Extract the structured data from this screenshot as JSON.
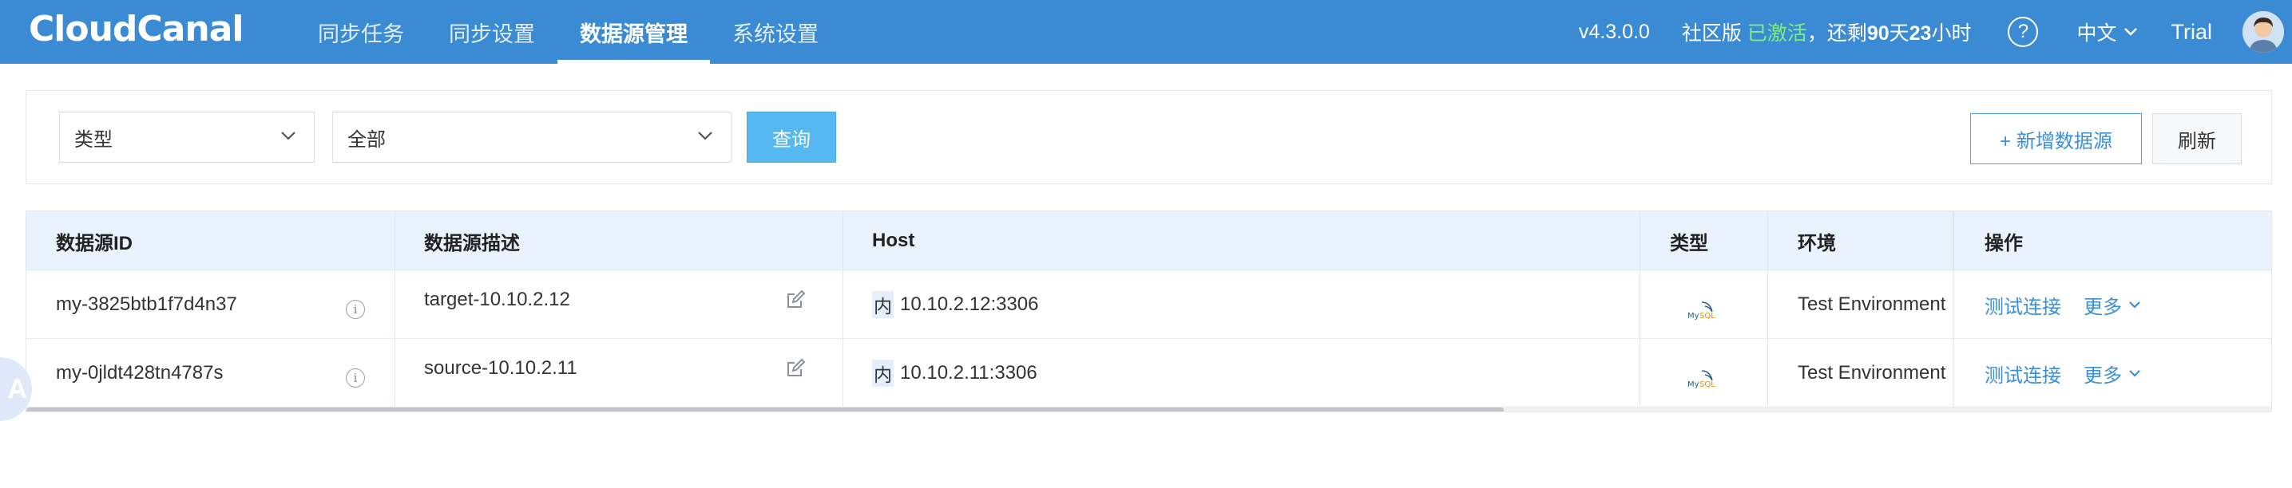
{
  "header": {
    "logo": "CloudCanal",
    "nav": [
      {
        "label": "同步任务",
        "active": false
      },
      {
        "label": "同步设置",
        "active": false
      },
      {
        "label": "数据源管理",
        "active": true
      },
      {
        "label": "系统设置",
        "active": false
      }
    ],
    "version": "v4.3.0.0",
    "edition_prefix": "社区版",
    "edition_status": "已激活",
    "remaining_prefix": "，还剩",
    "remaining_days": "90",
    "days_unit": "天",
    "remaining_hours": "23",
    "hours_unit": "小时",
    "help_icon": "?",
    "language": "中文",
    "trial": "Trial"
  },
  "filters": {
    "type_select": "类型",
    "scope_select": "全部",
    "query_button": "查询",
    "add_button": "+ 新增数据源",
    "refresh_button": "刷新"
  },
  "table": {
    "columns": [
      "数据源ID",
      "数据源描述",
      "Host",
      "类型",
      "环境",
      "操作"
    ],
    "rows": [
      {
        "id": "my-3825btb1f7d4n37",
        "description": "target-10.10.2.12",
        "host_tag": "内",
        "host": "10.10.2.12:3306",
        "type_icon": "mysql-logo",
        "environment": "Test Environment",
        "test_link": "测试连接",
        "more_link": "更多"
      },
      {
        "id": "my-0jldt428tn4787s",
        "description": "source-10.10.2.11",
        "host_tag": "内",
        "host": "10.10.2.11:3306",
        "type_icon": "mysql-logo",
        "environment": "Test Environment",
        "test_link": "测试连接",
        "more_link": "更多"
      }
    ]
  },
  "colors": {
    "header_bg": "#3a8bd3",
    "accent": "#3b8fd8",
    "query_button": "#55b8f0",
    "activated": "#7cf07c"
  },
  "floating_button": "A"
}
